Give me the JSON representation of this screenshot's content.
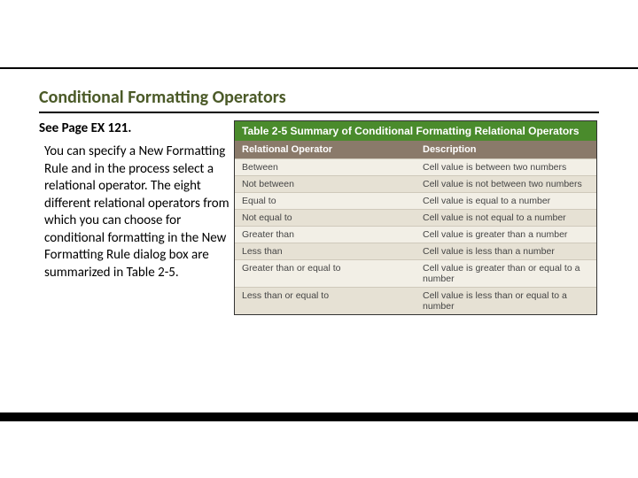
{
  "title": "Conditional Formatting Operators",
  "subhead": "See Page EX 121.",
  "body": "You can specify a New Formatting Rule and in the process select a relational operator. The eight different relational operators from which you can choose for conditional formatting in the New Formatting Rule dialog box are summarized in Table 2-5.",
  "table": {
    "caption": "Table 2-5 Summary of Conditional Formatting Relational Operators",
    "headers": {
      "col1": "Relational Operator",
      "col2": "Description"
    },
    "rows": [
      {
        "op": "Between",
        "desc": "Cell value is between two numbers"
      },
      {
        "op": "Not between",
        "desc": "Cell value is not between two numbers"
      },
      {
        "op": "Equal to",
        "desc": "Cell value is equal to a number"
      },
      {
        "op": "Not equal to",
        "desc": "Cell value is not equal to a number"
      },
      {
        "op": "Greater than",
        "desc": "Cell value is greater than a number"
      },
      {
        "op": "Less than",
        "desc": "Cell value is less than a number"
      },
      {
        "op": "Greater than or equal to",
        "desc": "Cell value is greater than or equal to a number"
      },
      {
        "op": "Less than or equal to",
        "desc": "Cell value is less than or equal to a number"
      }
    ]
  }
}
